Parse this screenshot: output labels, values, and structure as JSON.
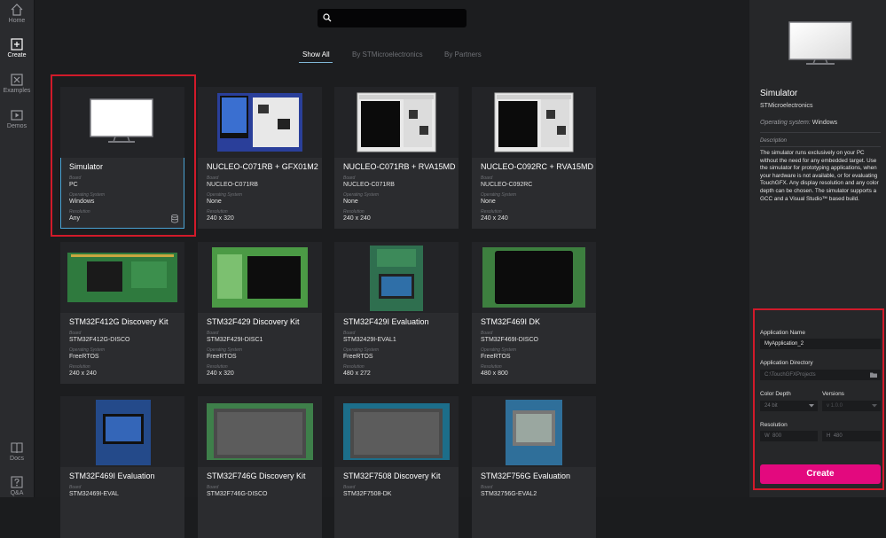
{
  "nav": {
    "home": "Home",
    "create": "Create",
    "examples": "Examples",
    "demos": "Demos",
    "docs": "Docs",
    "qa": "Q&A"
  },
  "search": {
    "value": "",
    "placeholder": ""
  },
  "filters": {
    "show_all": "Show All",
    "st": "By STMicroelectronics",
    "partners": "By Partners"
  },
  "field_labels": {
    "board": "Board",
    "os": "Operating System",
    "resolution": "Resolution"
  },
  "cards": [
    {
      "title": "Simulator",
      "board": "PC",
      "os": "Windows",
      "resolution": "Any"
    },
    {
      "title": "NUCLEO-C071RB + GFX01M2",
      "board": "NUCLEO-C071RB",
      "os": "None",
      "resolution": "240 x 320"
    },
    {
      "title": "NUCLEO-C071RB + RVA15MD",
      "board": "NUCLEO-C071RB",
      "os": "None",
      "resolution": "240 x 240"
    },
    {
      "title": "NUCLEO-C092RC + RVA15MD",
      "board": "NUCLEO-C092RC",
      "os": "None",
      "resolution": "240 x 240"
    },
    {
      "title": "STM32F412G Discovery Kit",
      "board": "STM32F412G-DISCO",
      "os": "FreeRTOS",
      "resolution": "240 x 240"
    },
    {
      "title": "STM32F429 Discovery Kit",
      "board": "STM32F429I-DISC1",
      "os": "FreeRTOS",
      "resolution": "240 x 320"
    },
    {
      "title": "STM32F429I Evaluation",
      "board": "STM32429I-EVAL1",
      "os": "FreeRTOS",
      "resolution": "480 x 272"
    },
    {
      "title": "STM32F469I DK",
      "board": "STM32F469I-DISCO",
      "os": "FreeRTOS",
      "resolution": "480 x 800"
    },
    {
      "title": "STM32F469I Evaluation",
      "board": "STM32469I-EVAL",
      "os": "",
      "resolution": ""
    },
    {
      "title": "STM32F746G Discovery Kit",
      "board": "STM32F746G-DISCO",
      "os": "",
      "resolution": ""
    },
    {
      "title": "STM32F7508 Discovery Kit",
      "board": "STM32F7508-DK",
      "os": "",
      "resolution": ""
    },
    {
      "title": "STM32F756G Evaluation",
      "board": "STM32756G-EVAL2",
      "os": "",
      "resolution": ""
    }
  ],
  "panel": {
    "title": "Simulator",
    "vendor": "STMicroelectronics",
    "os_label": "Operating system:",
    "os_value": "Windows",
    "description_label": "Description",
    "description": "The simulator runs exclusively on your PC without the need for any embedded target. Use the simulator for prototyping applications, when your hardware is not available, or for evaluating TouchGFX. Any display resolution and any color depth can be chosen. The simulator supports a GCC and a Visual Studio™ based build."
  },
  "form": {
    "app_name_label": "Application Name",
    "app_name_value": "MyApplication_2",
    "app_dir_label": "Application Directory",
    "app_dir_value": "C:\\TouchGFXProjects",
    "color_depth_label": "Color Depth",
    "color_depth_value": "24 bit",
    "versions_label": "Versions",
    "versions_value": "v 1.0.0",
    "resolution_label": "Resolution",
    "width_prefix": "W",
    "width_value": "800",
    "height_prefix": "H",
    "height_value": "480",
    "create_label": "Create"
  },
  "colors": {
    "accent": "#e3097e",
    "selected_outline": "#4aa3d4",
    "highlight_red": "#d11a2a"
  }
}
